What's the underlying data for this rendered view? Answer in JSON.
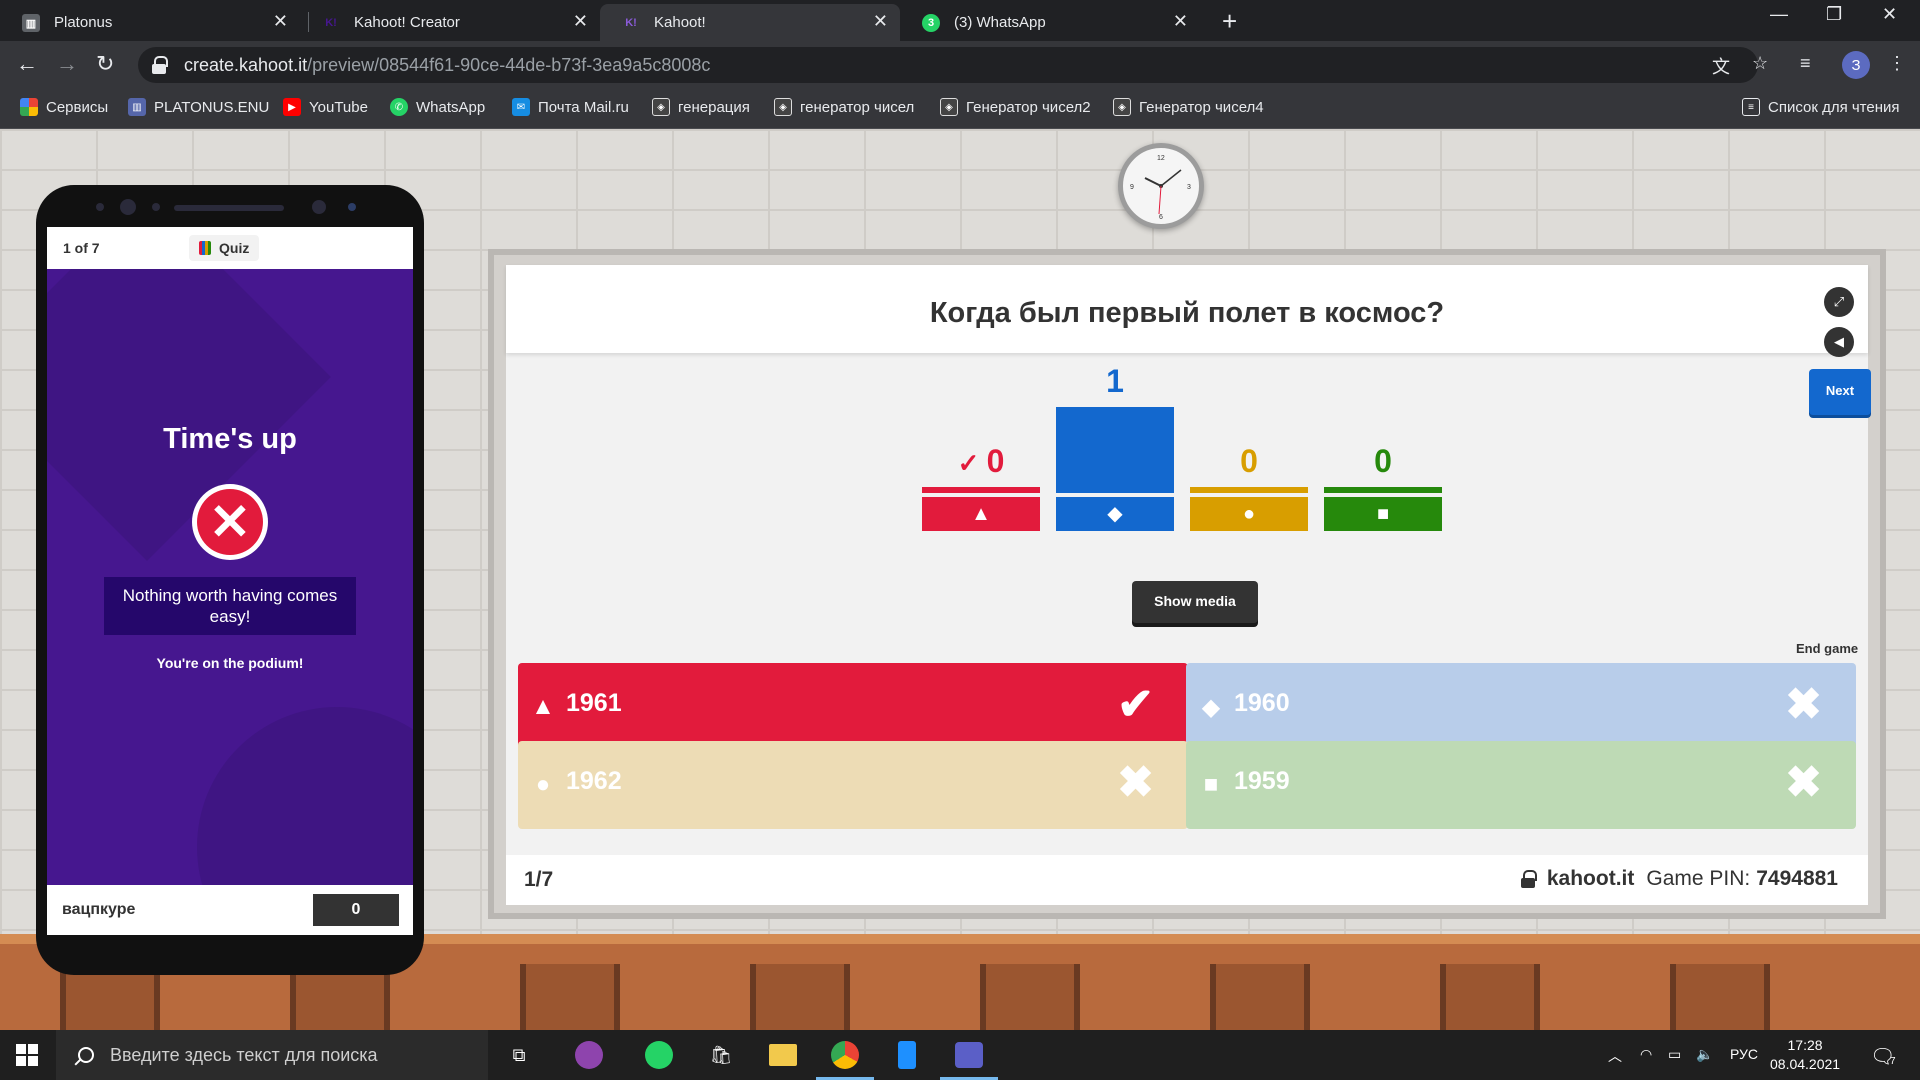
{
  "browser": {
    "tabs": [
      {
        "title": "Platonus",
        "active": false
      },
      {
        "title": "Kahoot! Creator",
        "active": false
      },
      {
        "title": "Kahoot!",
        "active": true
      },
      {
        "title": "(3) WhatsApp",
        "active": false
      }
    ],
    "url_host": "create.kahoot.it",
    "url_path": "/preview/08544f61-90ce-44de-b73f-3ea9a5c8008c",
    "profile_initial": "З",
    "bookmarks": [
      "Сервисы",
      "PLATONUS.ENU",
      "YouTube",
      "WhatsApp",
      "Почта Mail.ru",
      "генерация",
      "генератор чисел",
      "Генератор чисел2",
      "Генератор чисел4"
    ],
    "reading_list": "Список для чтения"
  },
  "phone": {
    "progress": "1 of 7",
    "mode": "Quiz",
    "title": "Time's up",
    "message": "Nothing worth having comes easy!",
    "podium": "You're on the podium!",
    "player_name": "вацпкуре",
    "player_score": "0"
  },
  "board": {
    "question": "Когда был первый полет в космос?",
    "next_label": "Next",
    "show_media_label": "Show media",
    "end_game_label": "End game",
    "counter": "1/7",
    "site": "kahoot.it",
    "pin_label": "Game PIN:",
    "pin": "7494881",
    "answers": [
      {
        "text": "1961",
        "shape": "triangle",
        "correct": true
      },
      {
        "text": "1960",
        "shape": "diamond",
        "correct": false
      },
      {
        "text": "1962",
        "shape": "circle",
        "correct": false
      },
      {
        "text": "1959",
        "shape": "square",
        "correct": false
      }
    ],
    "colors": {
      "red": "#e21b3c",
      "blue": "#1368ce",
      "yellow": "#d89e00",
      "green": "#26890c"
    }
  },
  "chart_data": {
    "type": "bar",
    "categories": [
      "triangle",
      "diamond",
      "circle",
      "square"
    ],
    "values": [
      0,
      1,
      0,
      0
    ],
    "correct": [
      true,
      false,
      false,
      false
    ]
  },
  "taskbar": {
    "search_placeholder": "Введите здесь текст для поиска",
    "language": "РУС",
    "time": "17:28",
    "date": "08.04.2021",
    "notifications": "7"
  }
}
